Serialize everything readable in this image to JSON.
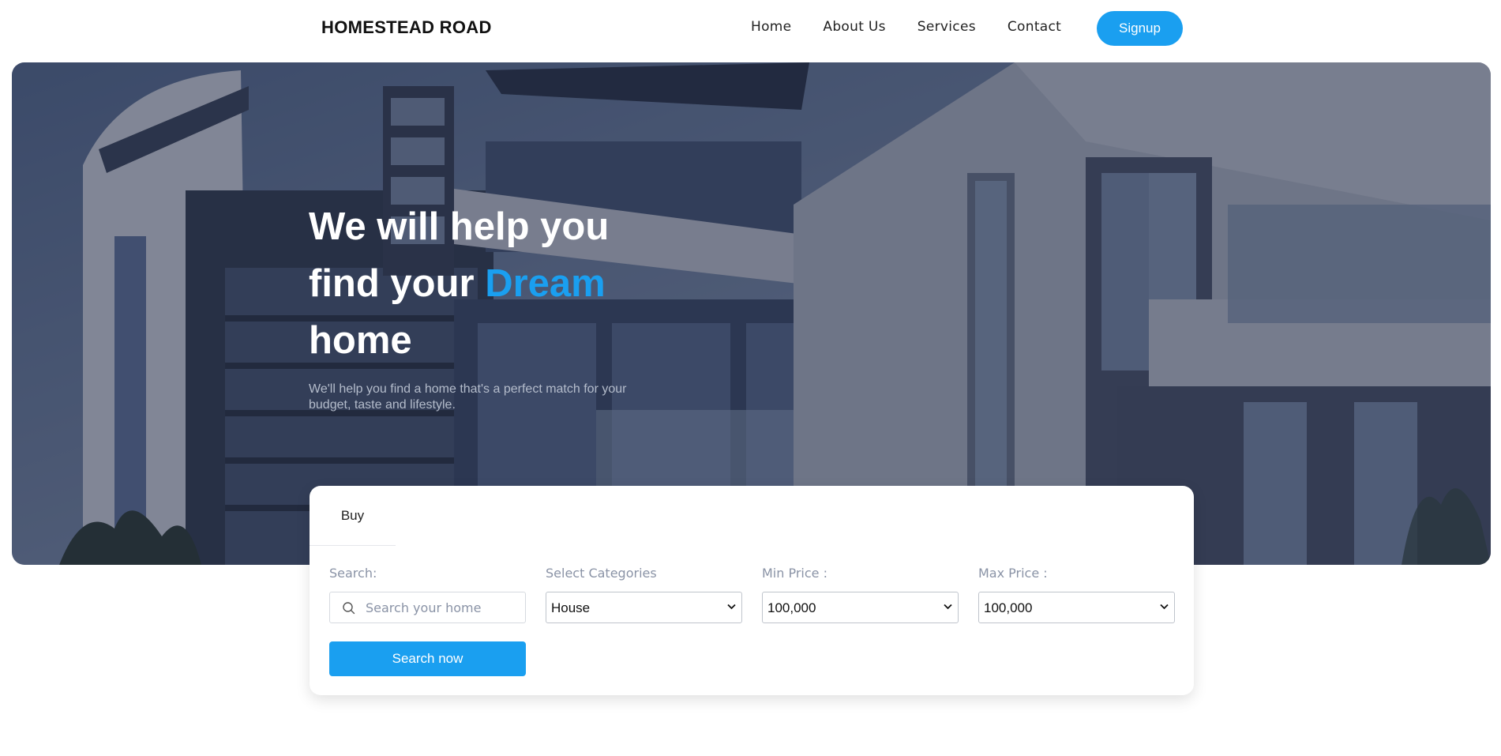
{
  "brand": {
    "name": "HOMESTEAD ROAD"
  },
  "nav": {
    "links": [
      "Home",
      "About Us",
      "Services",
      "Contact"
    ],
    "signup_label": "Signup"
  },
  "hero": {
    "title_line1": "We will help you",
    "title_line2": "find your ",
    "title_accent": "Dream",
    "title_line3": "home",
    "subtitle": "We'll help you find a home that's a perfect match for your budget, taste and lifestyle."
  },
  "search_form": {
    "tab_label": "Buy",
    "search_label": "Search:",
    "search_placeholder": "Search your home",
    "category_label": "Select Categories",
    "category_value": "House",
    "min_price_label": "Min Price :",
    "min_price_value": "100,000",
    "max_price_label": "Max Price :",
    "max_price_value": "100,000",
    "submit_label": "Search now"
  },
  "colors": {
    "accent": "#1a9ff0",
    "overlay": "#2a3550"
  },
  "icons": {
    "search": "search-icon",
    "dropdown": "chevron-down-icon"
  }
}
